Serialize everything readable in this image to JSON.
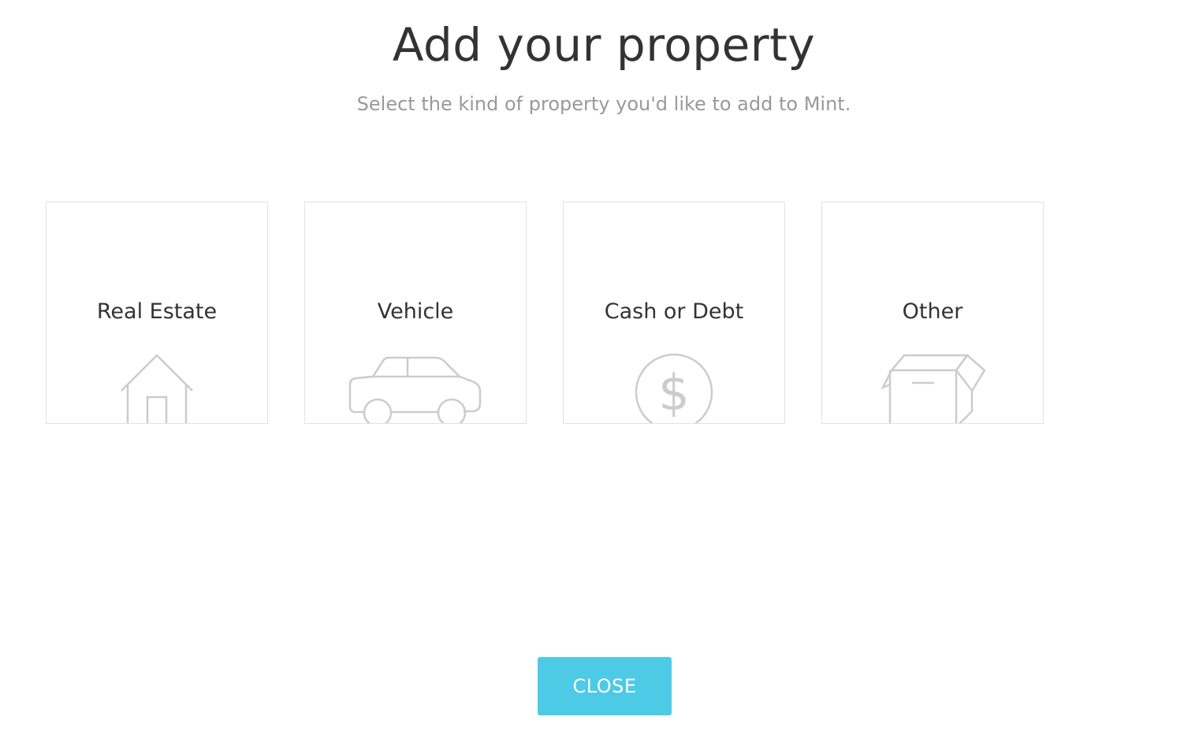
{
  "header": {
    "title": "Add your property",
    "subtitle": "Select the kind of property you'd like to add to Mint."
  },
  "property_types": [
    {
      "label": "Real Estate",
      "icon": "house-icon"
    },
    {
      "label": "Vehicle",
      "icon": "car-icon"
    },
    {
      "label": "Cash or Debt",
      "icon": "dollar-coin-icon"
    },
    {
      "label": "Other",
      "icon": "box-icon"
    }
  ],
  "footer": {
    "close_label": "CLOSE"
  },
  "colors": {
    "accent": "#4dcae6",
    "title_text": "#333333",
    "subtitle_text": "#999999",
    "card_border": "#e2e2e2",
    "icon_stroke": "#cccccc"
  }
}
